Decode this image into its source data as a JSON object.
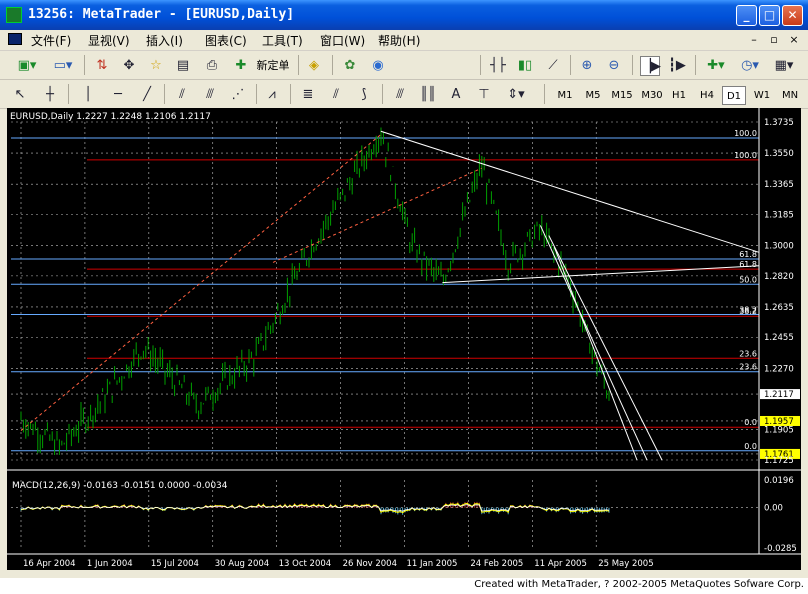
{
  "window": {
    "title": "13256: MetaTrader - [EURUSD,Daily]",
    "min": "_",
    "max": "□",
    "close": "✕"
  },
  "menu": {
    "items": [
      "文件(F)",
      "显视(V)",
      "插入(I)",
      "图表(C)",
      "工具(T)",
      "窗口(W)",
      "帮助(H)"
    ],
    "mdi_min": "–",
    "mdi_restore": "▫",
    "mdi_close": "×"
  },
  "toolbar1": {
    "new_order": "新定单"
  },
  "toolbar2": {
    "text_tool": "A",
    "timeframes": [
      "M1",
      "M5",
      "M15",
      "M30",
      "H1",
      "H4",
      "D1",
      "W1",
      "MN"
    ],
    "active_timeframe": "D1"
  },
  "chart": {
    "header": "EURUSD,Daily 1.2227 1.2248 1.2106 1.2117",
    "symbol": "EURUSD",
    "period": "Daily",
    "ohlc": {
      "open": 1.2227,
      "high": 1.2248,
      "low": 1.2106,
      "close": 1.2117
    },
    "price_range": [
      1.1725,
      1.3735
    ],
    "price_ticks": [
      "1.3735",
      "1.3550",
      "1.3365",
      "1.3185",
      "1.3000",
      "1.2820",
      "1.2635",
      "1.2455",
      "1.2270",
      "1.2117",
      "1.1957",
      "1.1905",
      "1.1761",
      "1.1725"
    ],
    "current_price": "1.2117",
    "marked_levels": [
      {
        "value": "1.1957",
        "style": "yellow"
      },
      {
        "value": "1.1761",
        "style": "yellow"
      }
    ],
    "fibo_sets": [
      {
        "name": "fibo-red",
        "levels": [
          {
            "label": "100.0",
            "price": 1.351
          },
          {
            "label": "61.8",
            "price": 1.286
          },
          {
            "label": "38.2",
            "price": 1.258
          },
          {
            "label": "23.6",
            "price": 1.233
          },
          {
            "label": "0.0",
            "price": 1.192
          }
        ]
      },
      {
        "name": "fibo-blue",
        "levels": [
          {
            "label": "100.0",
            "price": 1.364
          },
          {
            "label": "61.8",
            "price": 1.292
          },
          {
            "label": "50.0",
            "price": 1.277
          },
          {
            "label": "38.2",
            "price": 1.259
          },
          {
            "label": "23.6",
            "price": 1.225
          },
          {
            "label": "0.0",
            "price": 1.178
          }
        ]
      }
    ],
    "date_ticks": [
      "16 Apr 2004",
      "1 Jun 2004",
      "15 Jul 2004",
      "30 Aug 2004",
      "13 Oct 2004",
      "26 Nov 2004",
      "11 Jan 2005",
      "24 Feb 2005",
      "11 Apr 2005",
      "25 May 2005"
    ],
    "key_prices": [
      {
        "date": "2004-04-16",
        "price": 1.197
      },
      {
        "date": "2004-05-14",
        "price": 1.18
      },
      {
        "date": "2004-06-15",
        "price": 1.21
      },
      {
        "date": "2004-07-12",
        "price": 1.24
      },
      {
        "date": "2004-08-20",
        "price": 1.205
      },
      {
        "date": "2004-10-01",
        "price": 1.235
      },
      {
        "date": "2004-11-10",
        "price": 1.3
      },
      {
        "date": "2004-12-29",
        "price": 1.368
      },
      {
        "date": "2005-01-20",
        "price": 1.3
      },
      {
        "date": "2005-02-11",
        "price": 1.278
      },
      {
        "date": "2005-03-11",
        "price": 1.348
      },
      {
        "date": "2005-03-30",
        "price": 1.29
      },
      {
        "date": "2005-04-22",
        "price": 1.31
      },
      {
        "date": "2005-05-12",
        "price": 1.28
      },
      {
        "date": "2005-06-01",
        "price": 1.23
      },
      {
        "date": "2005-06-10",
        "price": 1.2117
      }
    ]
  },
  "macd": {
    "header": "MACD(12,26,9) -0.0163 -0.0151 0.0000 -0.0034",
    "params": "12,26,9",
    "values": [
      -0.0163,
      -0.0151,
      0.0,
      -0.0034
    ],
    "ticks": [
      "0.0196",
      "0.00",
      "-0.0285"
    ],
    "range": [
      -0.0285,
      0.0196
    ]
  },
  "colors": {
    "bg": "#000000",
    "candles": "#00a000",
    "grid": "#c0c0c0",
    "fibo_red": "#d00000",
    "fibo_blue": "#66aaff",
    "trend": "#ffffff",
    "macd_pos": "#b03030",
    "macd_neg": "#4aa3c8",
    "macd_main": "#ffff00",
    "macd_signal": "#ffffff"
  },
  "status": {
    "credit": "Created with MetaTrader, ? 2002-2005 MetaQuotes Sofware Corp."
  }
}
